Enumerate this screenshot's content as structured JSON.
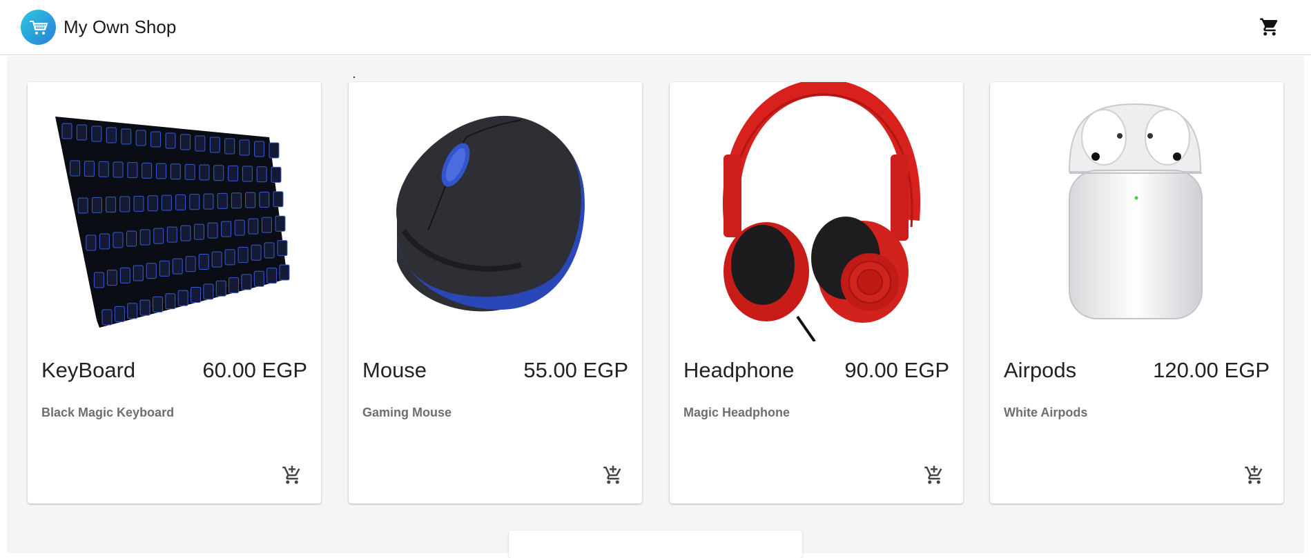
{
  "app": {
    "title": "My Own Shop",
    "logo_icon": "shopping-cart-icon",
    "header_cart_icon": "cart-icon",
    "brand_gradient": [
      "#2cc7e0",
      "#2a7fd6"
    ]
  },
  "products": [
    {
      "name": "KeyBoard",
      "price": "60.00 EGP",
      "description": "Black Magic Keyboard",
      "image": "keyboard-image",
      "action_icon": "add-to-cart-icon"
    },
    {
      "name": "Mouse",
      "price": "55.00 EGP",
      "description": "Gaming Mouse",
      "image": "mouse-image",
      "action_icon": "add-to-cart-icon"
    },
    {
      "name": "Headphone",
      "price": "90.00 EGP",
      "description": "Magic Headphone",
      "image": "headphone-image",
      "action_icon": "add-to-cart-icon"
    },
    {
      "name": "Airpods",
      "price": "120.00 EGP",
      "description": "White Airpods",
      "image": "airpods-image",
      "action_icon": "add-to-cart-icon"
    }
  ]
}
